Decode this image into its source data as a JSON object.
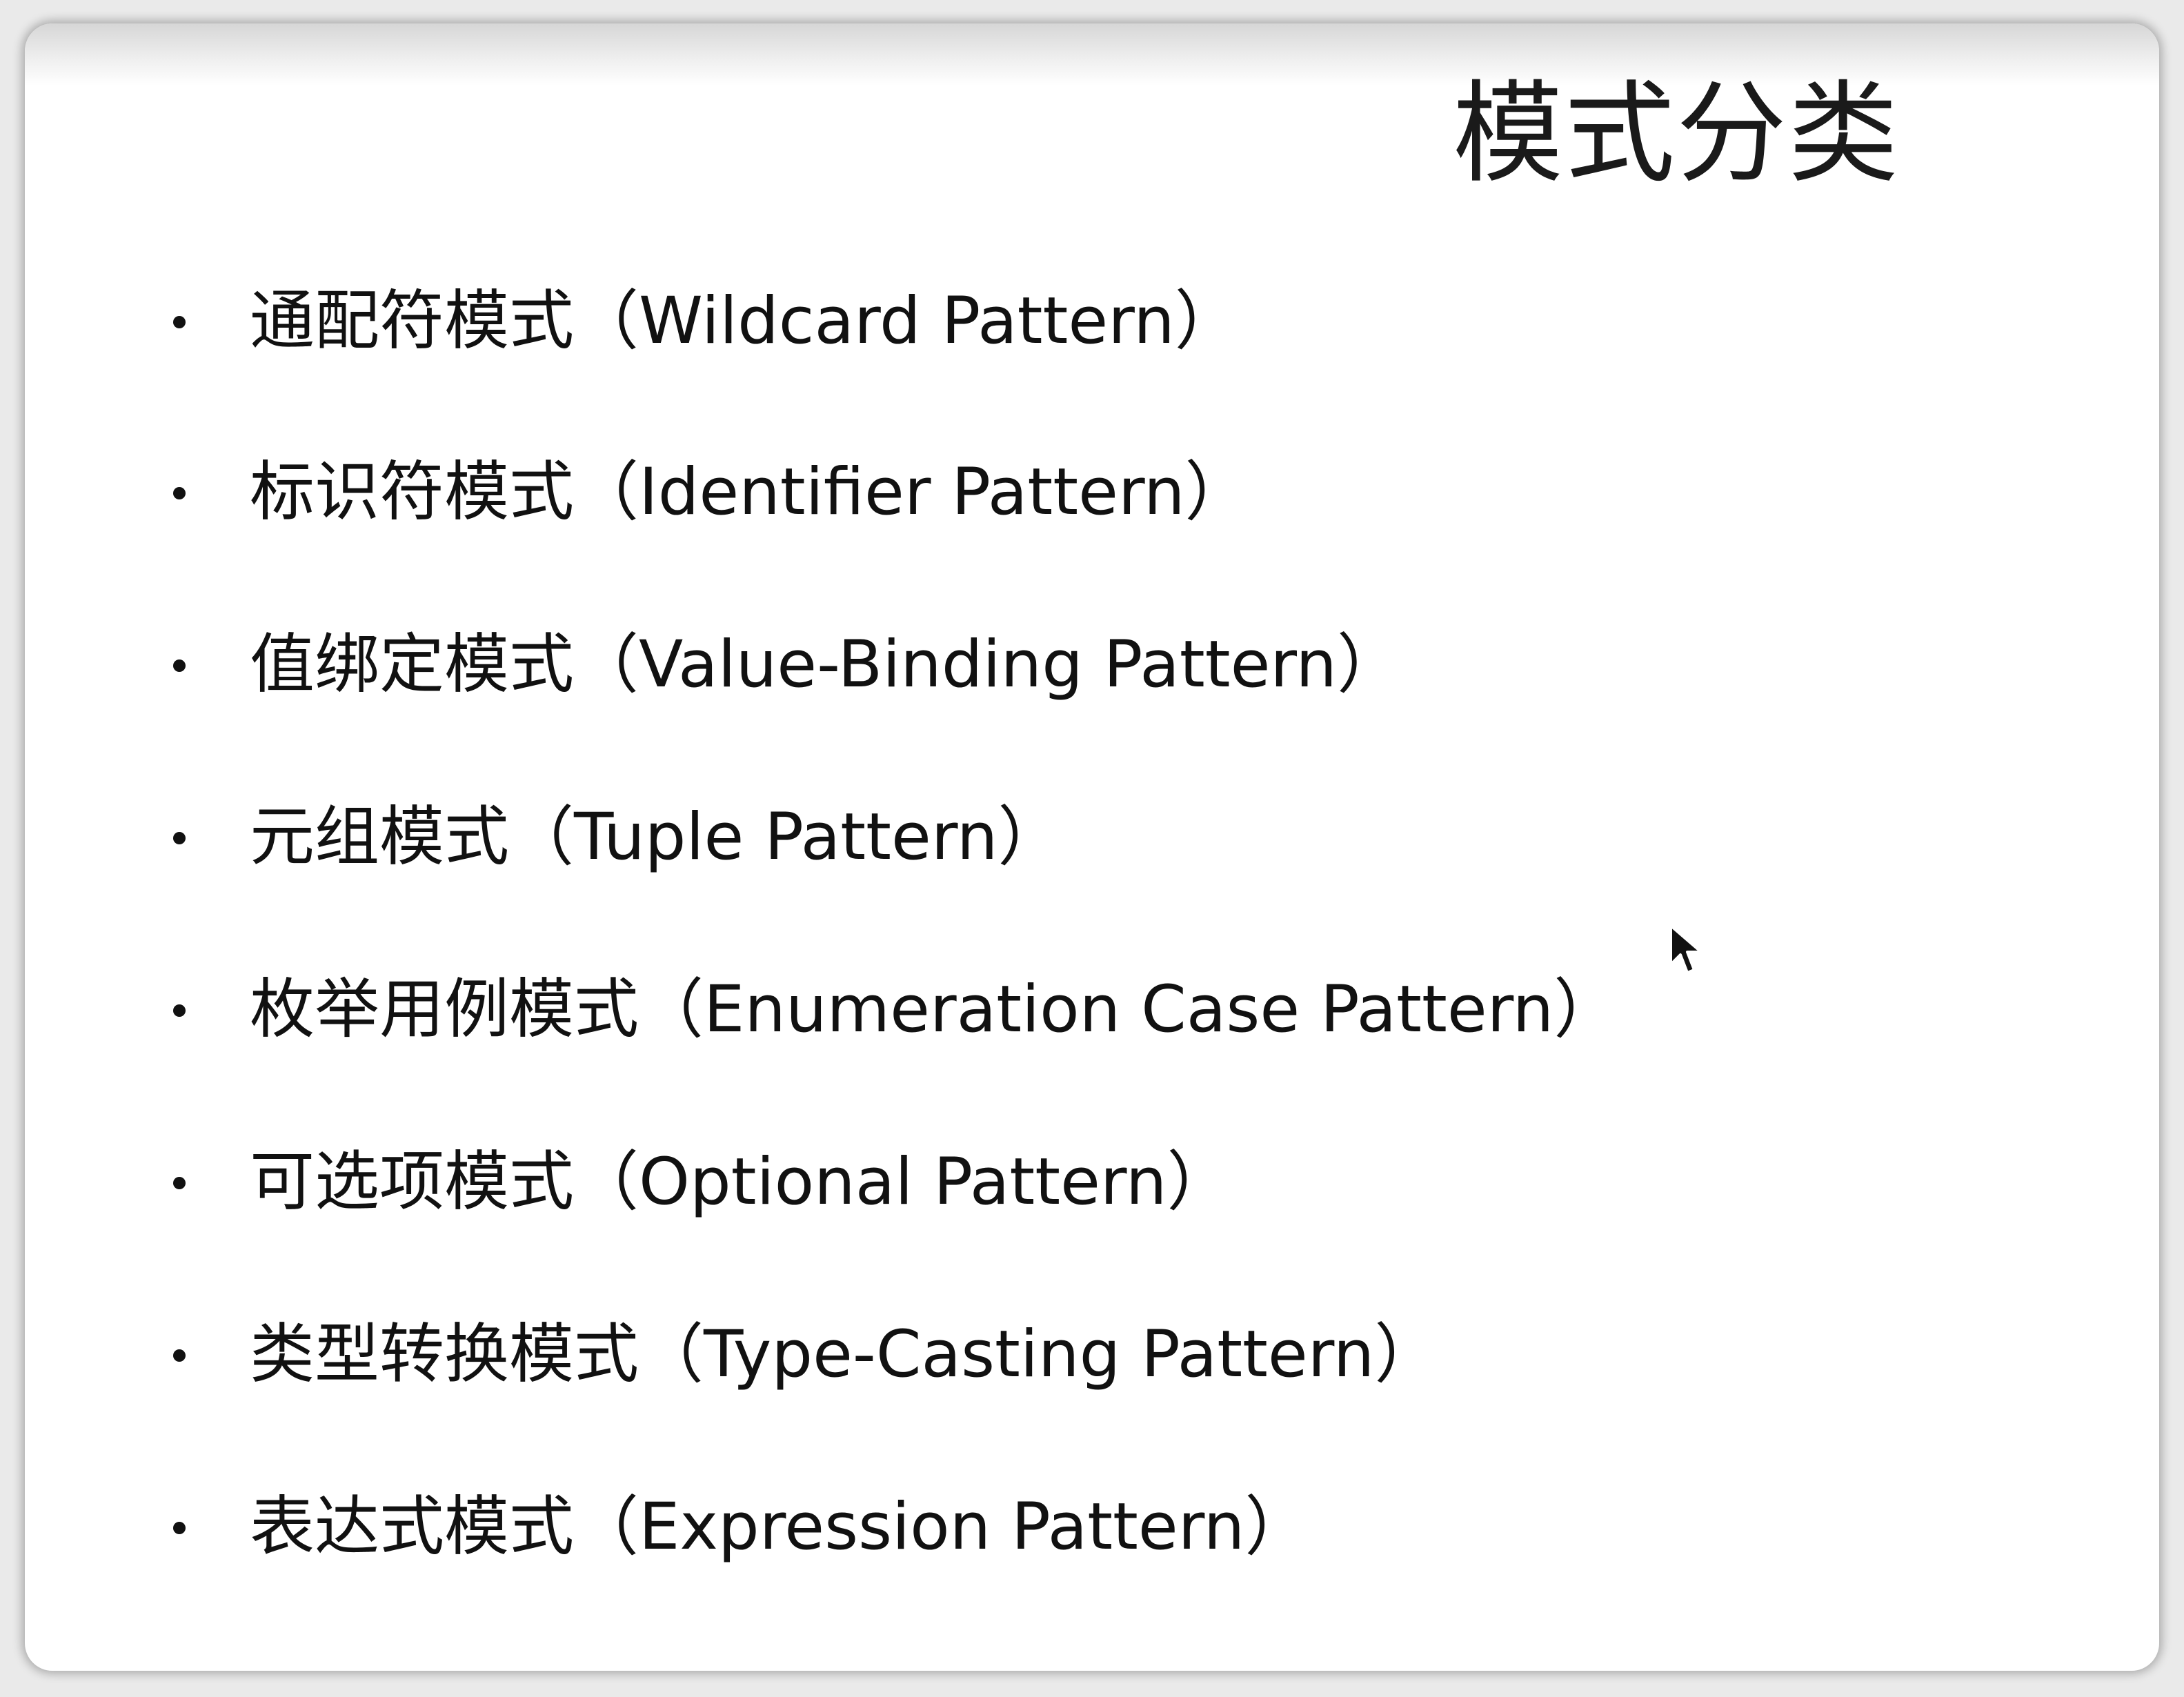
{
  "slide": {
    "title": "模式分类",
    "items": [
      {
        "label": "通配符模式（Wildcard Pattern）"
      },
      {
        "label": "标识符模式（Identifier Pattern）"
      },
      {
        "label": "值绑定模式（Value-Binding Pattern）"
      },
      {
        "label": "元组模式（Tuple Pattern）"
      },
      {
        "label": "枚举用例模式（Enumeration Case Pattern）"
      },
      {
        "label": "可选项模式（Optional Pattern）"
      },
      {
        "label": "类型转换模式（Type-Casting Pattern）"
      },
      {
        "label": "表达式模式（Expression Pattern）"
      }
    ]
  },
  "icons": {
    "bullet": "bullet-dot",
    "cursor": "mouse-pointer-icon"
  },
  "colors": {
    "text": "#111111",
    "background": "#ffffff"
  }
}
